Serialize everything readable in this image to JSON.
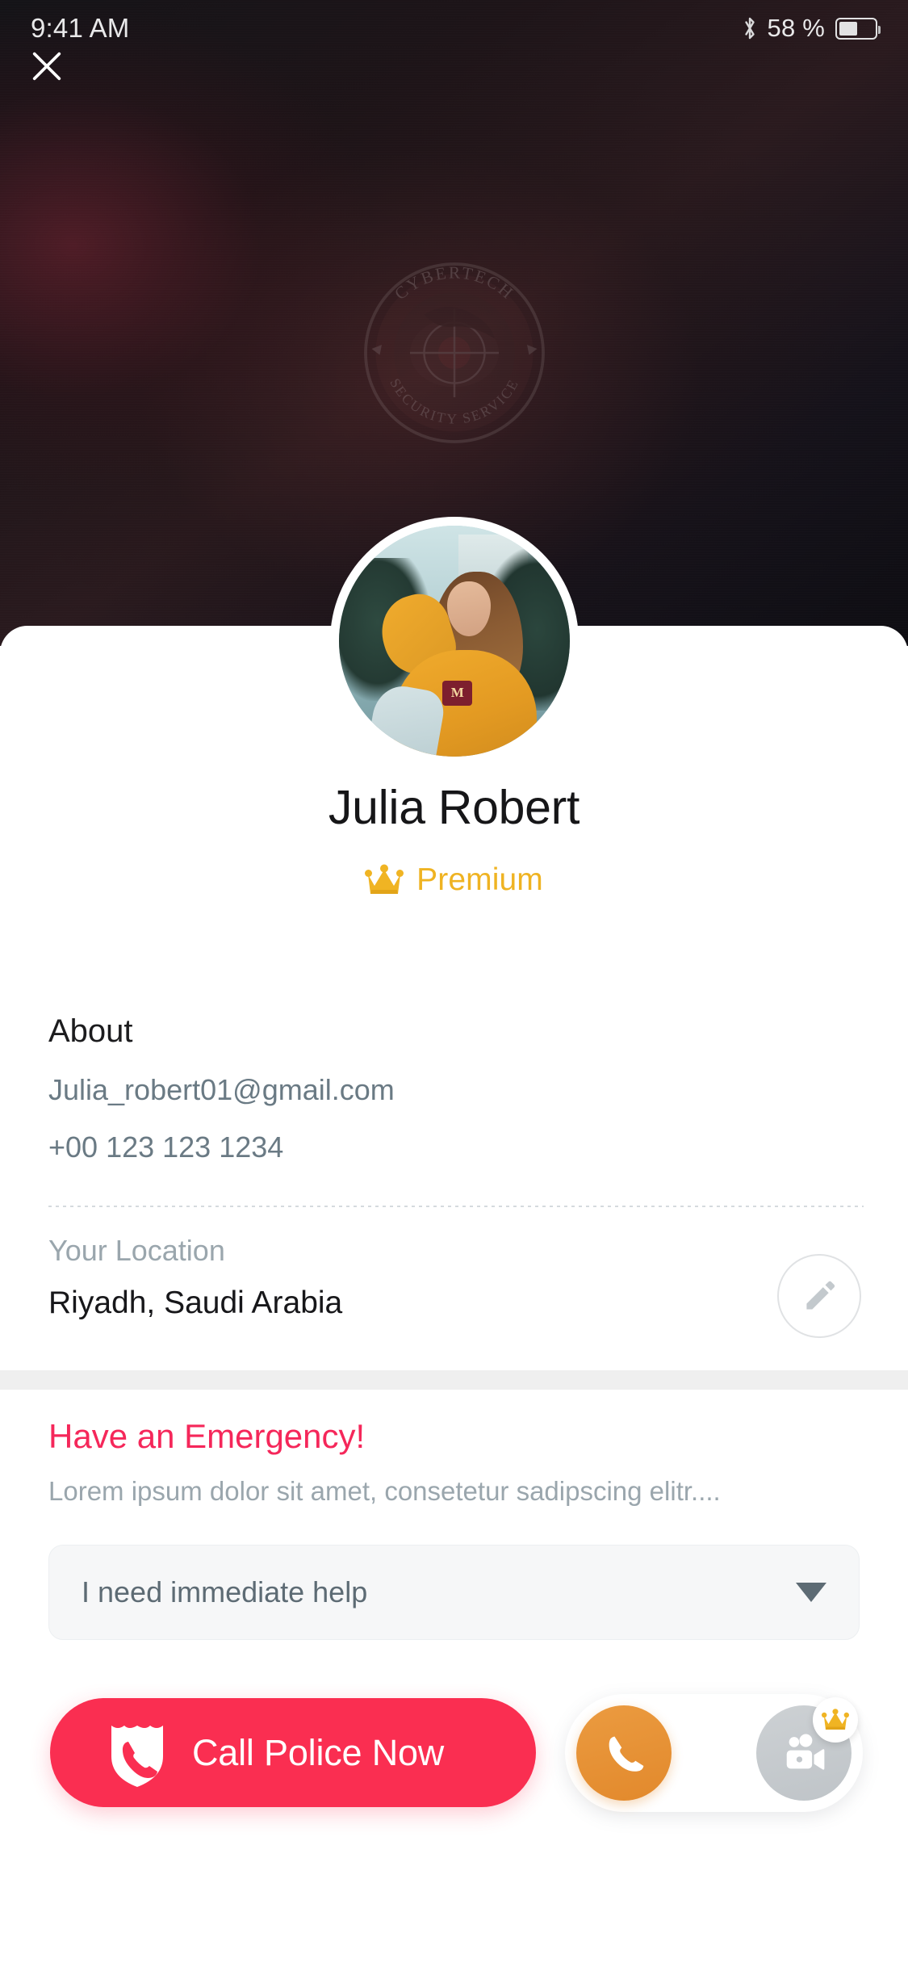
{
  "status_bar": {
    "time": "9:41 AM",
    "battery_percent": "58 %",
    "bluetooth_icon": "bluetooth-icon",
    "battery_icon": "battery-icon"
  },
  "header": {
    "close_icon": "close-icon",
    "watermark": {
      "top_text": "CYBERTECH",
      "bottom_text": "SECURITY SERVICE"
    }
  },
  "profile": {
    "avatar_alt": "avatar",
    "avatar_patch_letter": "M",
    "name": "Julia Robert",
    "membership_label": "Premium",
    "membership_icon": "crown-icon",
    "membership_color": "#efb322"
  },
  "about": {
    "title": "About",
    "email": "Julia_robert01@gmail.com",
    "phone": "+00 123 123 1234"
  },
  "location": {
    "label": "Your Location",
    "value": "Riyadh, Saudi Arabia",
    "edit_icon": "pencil-icon"
  },
  "emergency": {
    "title": "Have an Emergency!",
    "title_color": "#f5275a",
    "description": "Lorem ipsum dolor sit amet, consetetur sadipscing elitr....",
    "dropdown": {
      "selected": "I need immediate help",
      "caret_icon": "chevron-down-icon"
    }
  },
  "actions": {
    "call_police": {
      "label": "Call Police Now",
      "icon": "police-badge-phone-icon",
      "color": "#fa2e51"
    },
    "voice_call": {
      "icon": "phone-icon",
      "color": "#e2892c"
    },
    "video_call": {
      "icon": "video-camera-icon",
      "color": "#c3c8cc",
      "locked_badge_icon": "crown-icon"
    }
  }
}
